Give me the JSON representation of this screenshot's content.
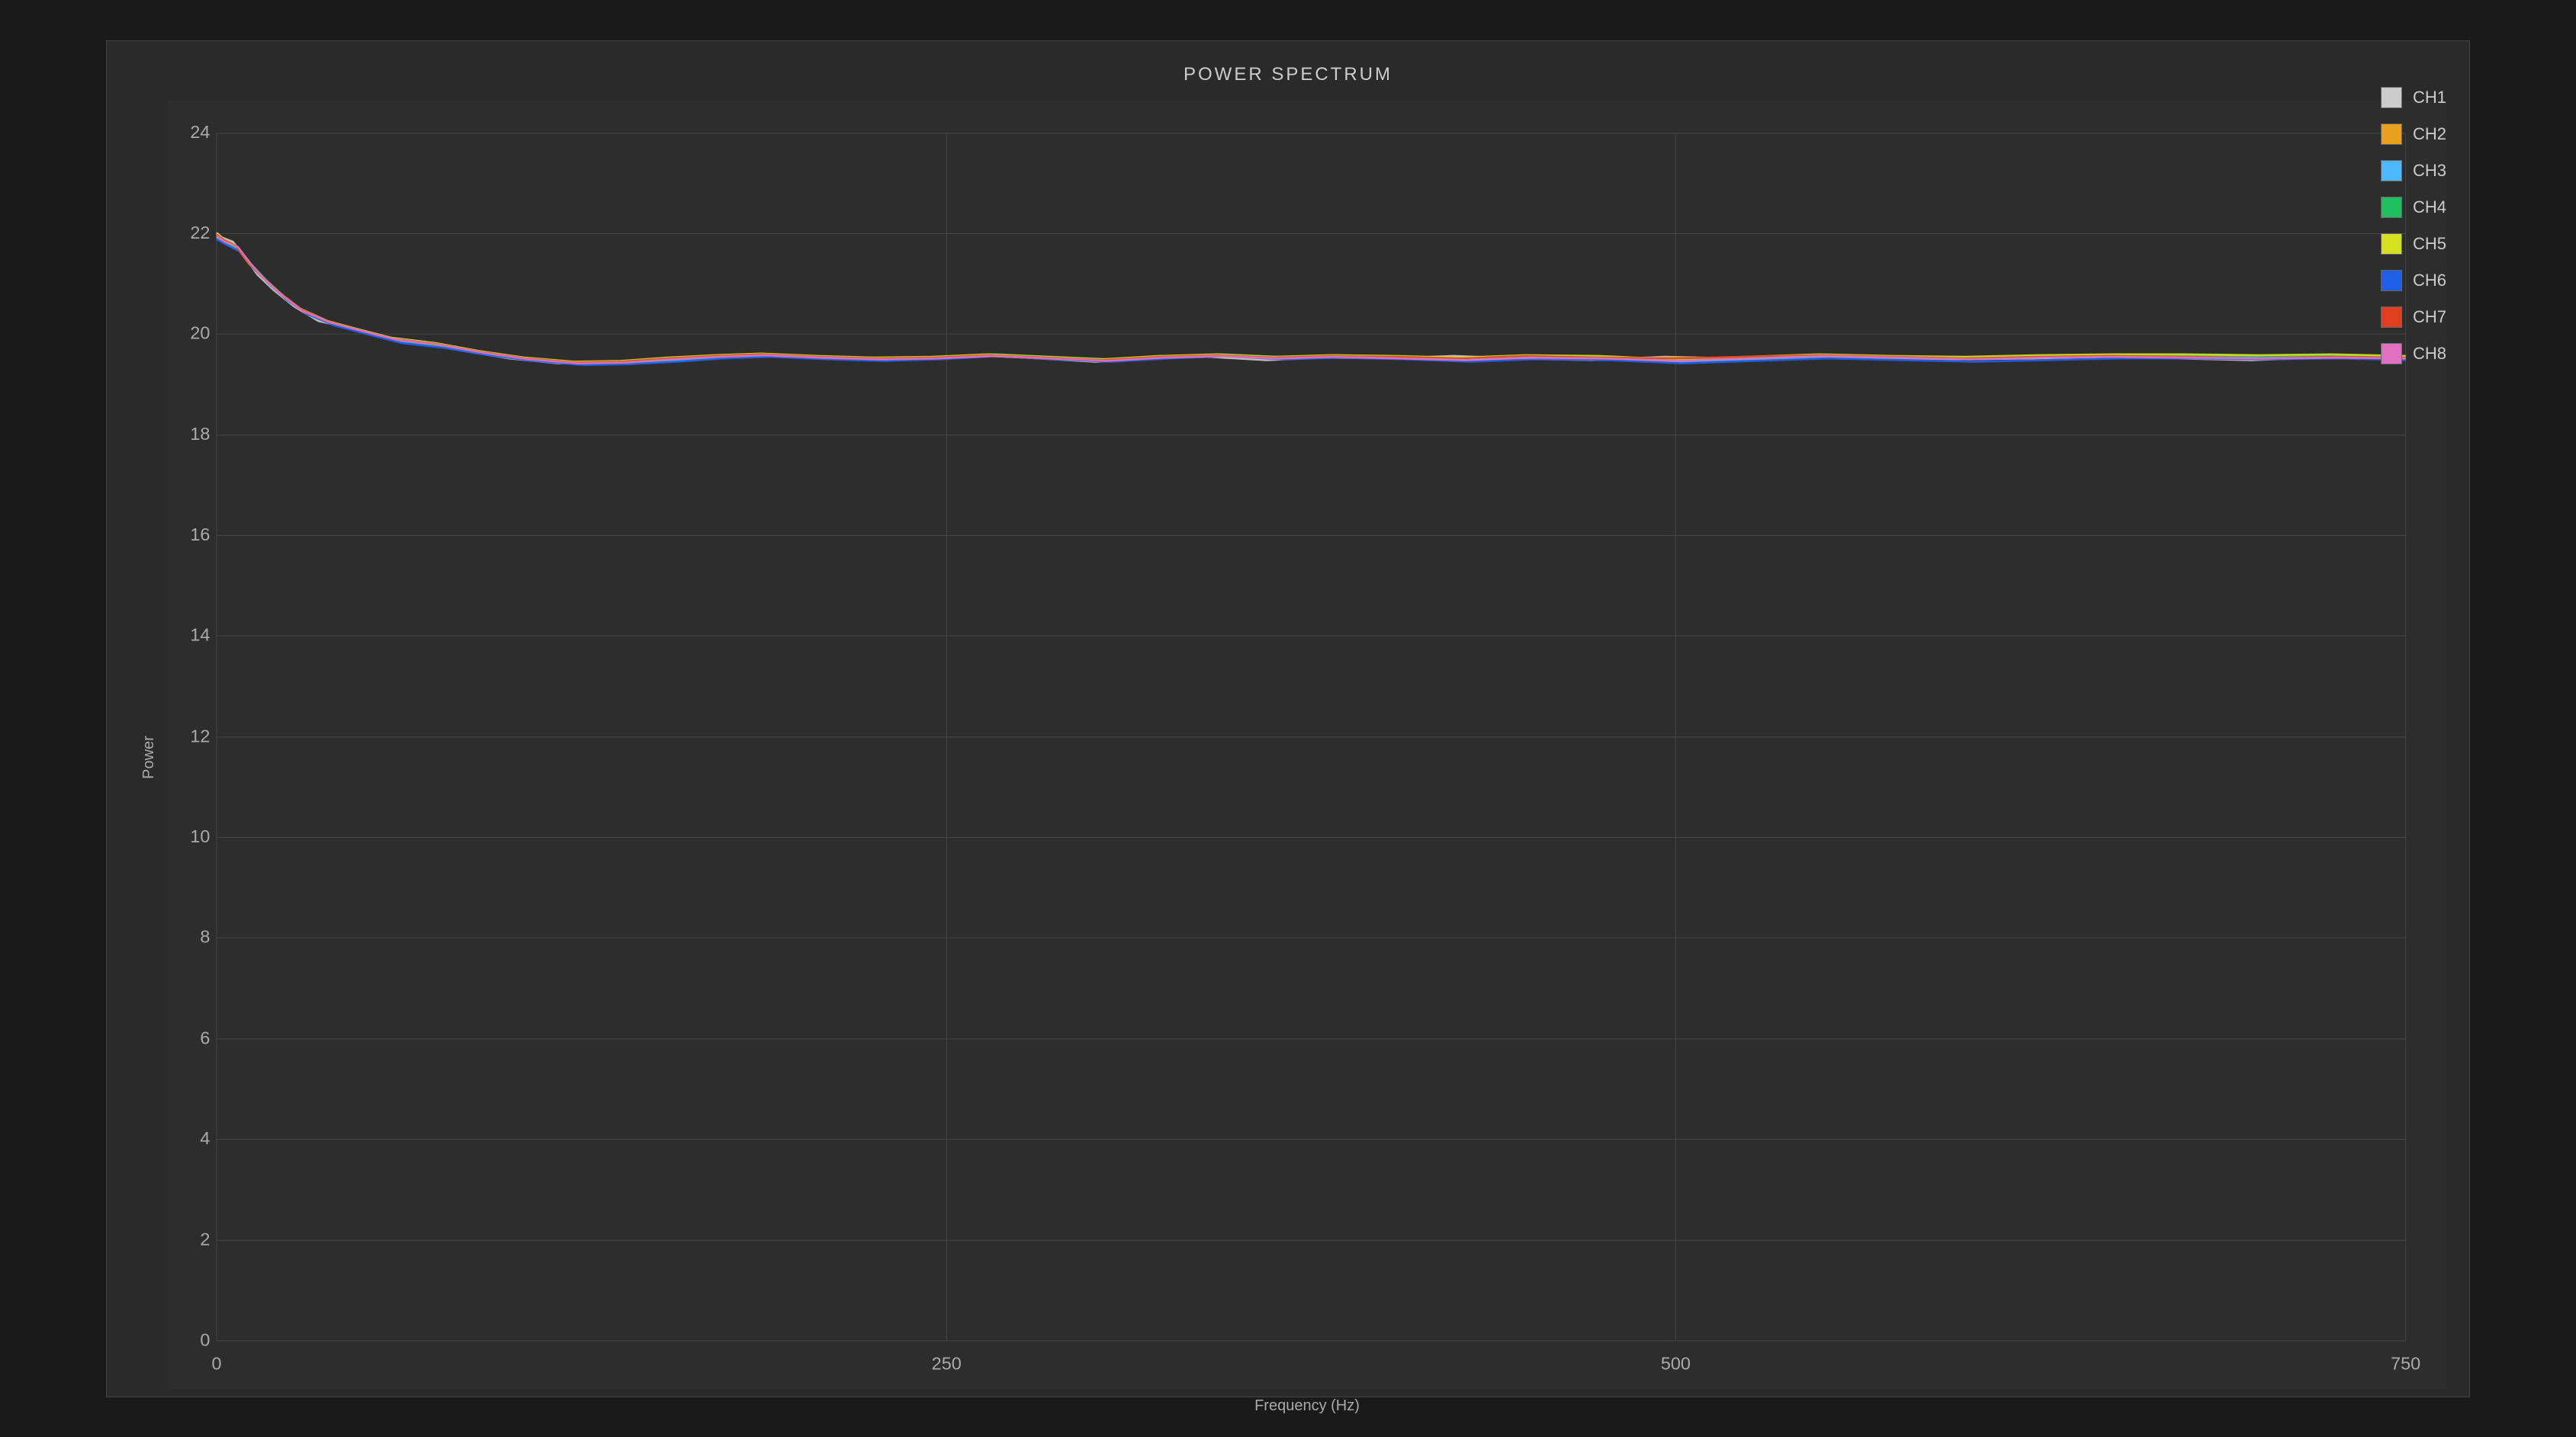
{
  "chart": {
    "title": "POWER SPECTRUM",
    "x_axis_label": "Frequency (Hz)",
    "y_axis_label": "Power",
    "x_ticks": [
      "0",
      "250",
      "500",
      "750"
    ],
    "y_ticks": [
      "0",
      "2",
      "4",
      "6",
      "8",
      "10",
      "12",
      "14",
      "16",
      "18",
      "20",
      "22",
      "24"
    ],
    "legend": [
      {
        "label": "CH1",
        "color": "#cccccc"
      },
      {
        "label": "CH2",
        "color": "#e8a020"
      },
      {
        "label": "CH3",
        "color": "#4db8ff"
      },
      {
        "label": "CH4",
        "color": "#20c060"
      },
      {
        "label": "CH5",
        "color": "#d4e020"
      },
      {
        "label": "CH6",
        "color": "#2060e8"
      },
      {
        "label": "CH7",
        "color": "#e04020"
      },
      {
        "label": "CH8",
        "color": "#e070c0"
      }
    ]
  }
}
